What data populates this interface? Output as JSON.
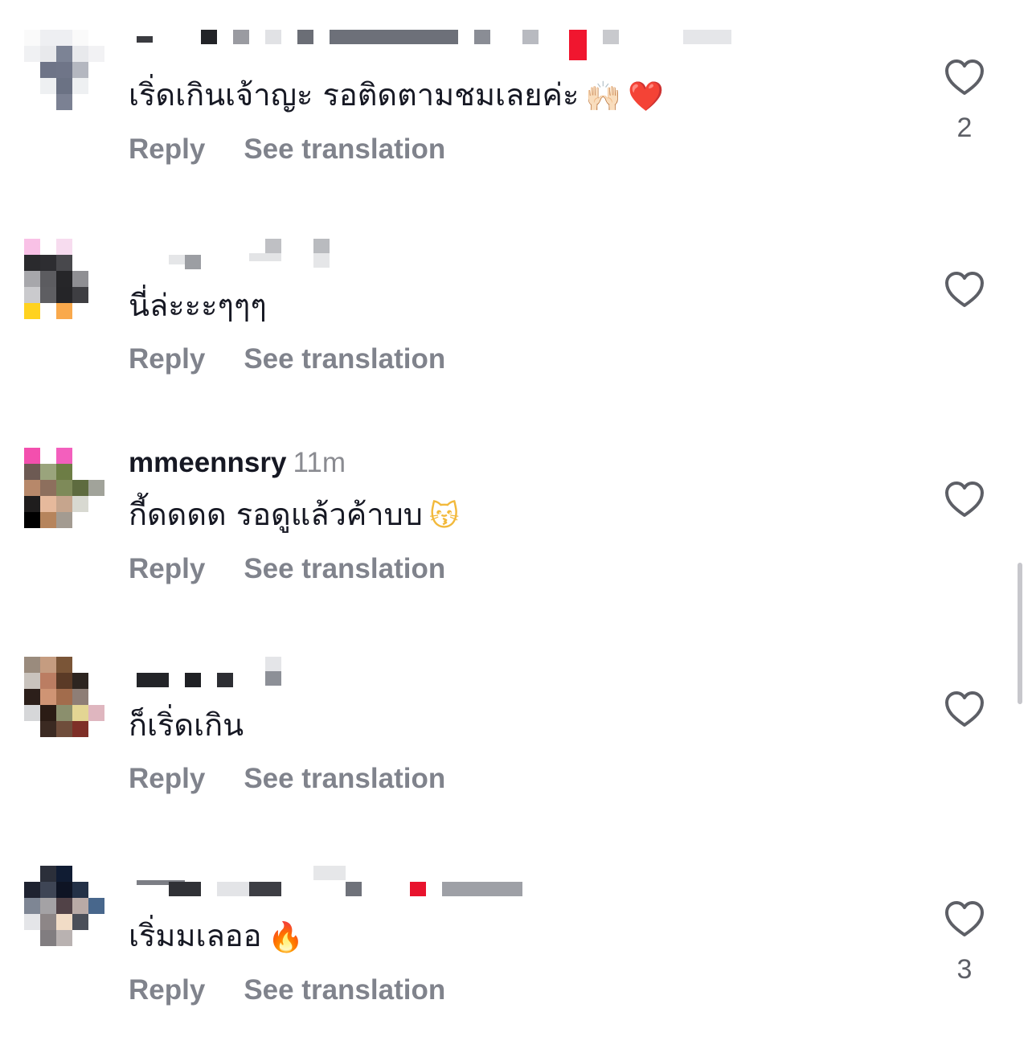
{
  "actions": {
    "reply": "Reply",
    "see_translation": "See translation"
  },
  "comments": [
    {
      "username": "",
      "time": "",
      "text": "เริ่ดเกินเจ้าญะ รอติดตามชมเลยค่ะ",
      "emojis": [
        "🙌🏻",
        "❤️"
      ],
      "likes": "2"
    },
    {
      "username": "",
      "time": "",
      "text": "นี่ล่ะะะๆๆๆ",
      "emojis": [],
      "likes": ""
    },
    {
      "username": "mmeennsry",
      "time": "11m",
      "text": "กี้ดดดด รอดูแล้วค้าบบ",
      "emojis": [
        "😽"
      ],
      "likes": ""
    },
    {
      "username": "",
      "time": "",
      "text": "ก็เริ่ดเกิน",
      "emojis": [],
      "likes": ""
    },
    {
      "username": "",
      "time": "",
      "text": "เริ่มมเลออ",
      "emojis": [
        "🔥"
      ],
      "likes": "3"
    }
  ],
  "icons": {
    "like": "heart-outline-icon"
  },
  "colors": {
    "username": "#161823",
    "secondary_text": "#80838c",
    "like_count": "#5d5f66",
    "scrollbar": "#c7c7cc"
  }
}
